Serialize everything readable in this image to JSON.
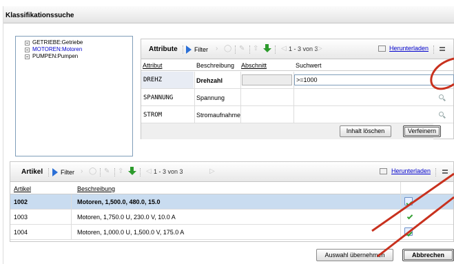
{
  "window": {
    "title": "Klassifikationssuche"
  },
  "tree": {
    "items": [
      {
        "label": "GETRIEBE:Getriebe",
        "selected": false
      },
      {
        "label": "MOTOREN:Motoren",
        "selected": true
      },
      {
        "label": "PUMPEN:Pumpen",
        "selected": false
      }
    ]
  },
  "attribute_panel": {
    "title": "Attribute",
    "filter_label": "Filter",
    "pager_text": "1 - 3 von 3",
    "download_label": "Herunterladen",
    "columns": [
      "Attribut",
      "Beschreibung",
      "Abschnitt",
      "Suchwert"
    ],
    "rows": [
      {
        "attribut": "DREHZ",
        "beschreibung": "Drehzahl",
        "abschnitt": "",
        "suchwert": ">=1000"
      },
      {
        "attribut": "SPANNUNG",
        "beschreibung": "Spannung",
        "abschnitt": "",
        "suchwert": ""
      },
      {
        "attribut": "STROM",
        "beschreibung": "Stromaufnahme",
        "abschnitt": "",
        "suchwert": ""
      }
    ],
    "clear_button": "Inhalt löschen",
    "refine_button": "Verfeinern"
  },
  "artikel_panel": {
    "title": "Artikel",
    "filter_label": "Filter",
    "pager_text": "1 - 3 von 3",
    "download_label": "Herunterladen",
    "columns": [
      "Artikel",
      "Beschreibung"
    ],
    "rows": [
      {
        "artikel": "1002",
        "beschreibung": "Motoren, 1,500.0, 480.0, 15.0",
        "selected": true
      },
      {
        "artikel": "1003",
        "beschreibung": "Motoren, 1,750.0 U, 230.0 V, 10.0 A",
        "selected": false
      },
      {
        "artikel": "1004",
        "beschreibung": "Motoren, 1,000.0 U, 1,500.0 V, 175.0 A",
        "selected": false
      }
    ]
  },
  "buttons": {
    "accept": "Auswahl übernehmen",
    "cancel": "Abbrechen"
  },
  "colors": {
    "selection": "#c9dcf0",
    "annotation": "#c8311e",
    "link": "#0000cc",
    "filter_accent": "#2b6fd6"
  }
}
